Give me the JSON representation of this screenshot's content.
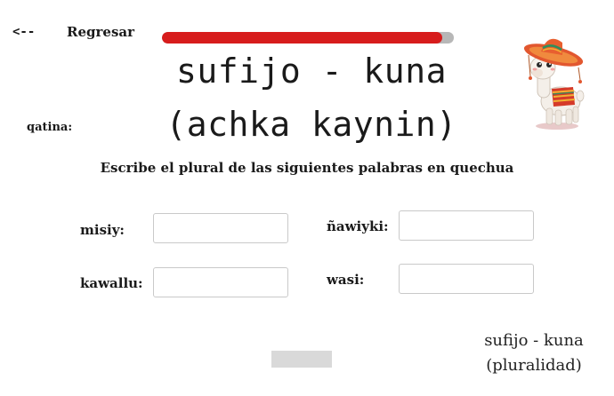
{
  "nav": {
    "back_arrow": "<--",
    "back_label": "Regresar"
  },
  "progress": {
    "fraction": 0.96,
    "fill_color": "#d71c1c",
    "track_color": "#b7b7b7"
  },
  "title": {
    "line1": "sufijo - kuna",
    "line2": "(achka kaynin)"
  },
  "score": {
    "label": "qatina:"
  },
  "instructions": "Escribe el plural de las siguientes palabras en quechua",
  "fields": [
    {
      "label": "misiy:",
      "value": ""
    },
    {
      "label": "ñawiyki:",
      "value": ""
    },
    {
      "label": "kawallu:",
      "value": ""
    },
    {
      "label": "wasi:",
      "value": ""
    }
  ],
  "footer": {
    "line1": "sufijo - kuna",
    "line2": "(pluralidad)"
  },
  "mascot": {
    "icon": "llama-sombrero-icon"
  }
}
